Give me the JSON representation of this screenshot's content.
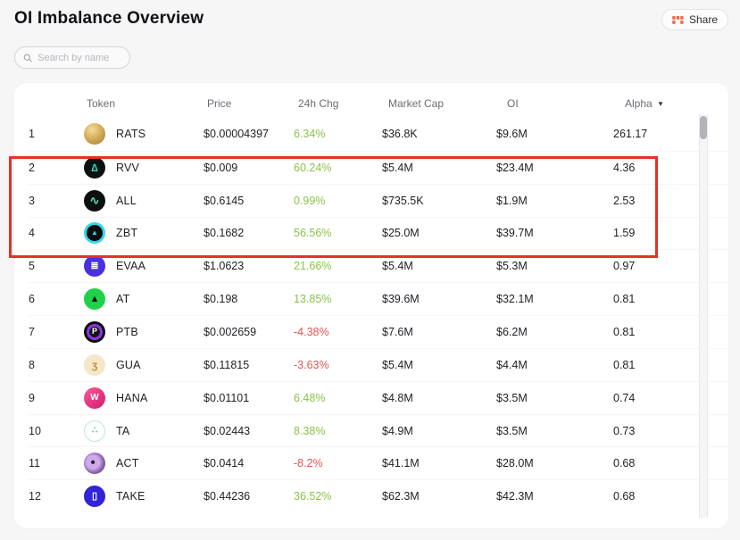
{
  "page": {
    "title": "OI Imbalance Overview"
  },
  "header": {
    "share_label": "Share",
    "share_icon": "blocks-icon",
    "share_icon_color": "#f26a4b"
  },
  "search": {
    "placeholder": "Search by name",
    "icon": "search-icon"
  },
  "colors": {
    "positive": "#8bc34a",
    "negative": "#e8544c"
  },
  "table": {
    "columns": [
      "Token",
      "Price",
      "24h Chg",
      "Market Cap",
      "OI",
      "Alpha"
    ],
    "sort_column": "Alpha",
    "sort_caret": "▾",
    "highlight": {
      "rows": [
        2,
        3,
        4
      ],
      "border_color": "#e53126"
    },
    "rows": [
      {
        "rank": "1",
        "symbol": "RATS",
        "price": "$0.00004397",
        "change": "6.34%",
        "market_cap": "$36.8K",
        "oi": "$9.6M",
        "alpha": "261.17",
        "icon": {
          "name": "rats-coin-icon",
          "bg": "radial-gradient(circle at 38% 30%, #f4dc96, #d2a957 50%, #a8823a 95%)",
          "glyph": "",
          "color": "#8a6a2a",
          "size": "9px"
        }
      },
      {
        "rank": "2",
        "symbol": "RVV",
        "price": "$0.009",
        "change": "60.24%",
        "market_cap": "$5.4M",
        "oi": "$23.4M",
        "alpha": "4.36",
        "icon": {
          "name": "rvv-icon",
          "bg": "#0c1110",
          "glyph": "∆",
          "color": "#2fd0bd",
          "size": "12px"
        }
      },
      {
        "rank": "3",
        "symbol": "ALL",
        "price": "$0.6145",
        "change": "0.99%",
        "market_cap": "$735.5K",
        "oi": "$1.9M",
        "alpha": "2.53",
        "icon": {
          "name": "all-icon",
          "bg": "#0c1110",
          "glyph": "∿",
          "color": "#64d9a8",
          "size": "13px"
        }
      },
      {
        "rank": "4",
        "symbol": "ZBT",
        "price": "$0.1682",
        "change": "56.56%",
        "market_cap": "$25.0M",
        "oi": "$39.7M",
        "alpha": "1.59",
        "icon": {
          "name": "zbt-icon",
          "bg": "#0b0d0d",
          "border": "3px solid #38d5e8",
          "glyph": "▲",
          "color": "#38d5e8",
          "size": "8px"
        }
      },
      {
        "rank": "5",
        "symbol": "EVAA",
        "price": "$1.0623",
        "change": "21.66%",
        "market_cap": "$5.4M",
        "oi": "$5.3M",
        "alpha": "0.97",
        "icon": {
          "name": "evaa-icon",
          "bg": "#4a30e2",
          "glyph": "≣",
          "color": "#ffffff",
          "size": "11px"
        }
      },
      {
        "rank": "6",
        "symbol": "AT",
        "price": "$0.198",
        "change": "13.85%",
        "market_cap": "$39.6M",
        "oi": "$32.1M",
        "alpha": "0.81",
        "icon": {
          "name": "at-icon",
          "bg": "#1ed24b",
          "glyph": "▲",
          "color": "#0d0f0d",
          "size": "11px"
        }
      },
      {
        "rank": "7",
        "symbol": "PTB",
        "price": "$0.002659",
        "change": "-4.38%",
        "market_cap": "$7.6M",
        "oi": "$6.2M",
        "alpha": "0.81",
        "icon": {
          "name": "ptb-icon",
          "bg": "radial-gradient(circle, #16161a 0 34%, #8d34e6 36% 52%, #0b0b0e 54%)",
          "glyph": "P",
          "color": "#ffffff",
          "size": "9px"
        }
      },
      {
        "rank": "8",
        "symbol": "GUA",
        "price": "$0.11815",
        "change": "-3.63%",
        "market_cap": "$5.4M",
        "oi": "$4.4M",
        "alpha": "0.81",
        "icon": {
          "name": "gua-icon",
          "bg": "#f5e7c8",
          "glyph": "ʒ",
          "color": "#bd8f4c",
          "size": "12px"
        }
      },
      {
        "rank": "9",
        "symbol": "HANA",
        "price": "$0.01101",
        "change": "6.48%",
        "market_cap": "$4.8M",
        "oi": "$3.5M",
        "alpha": "0.74",
        "icon": {
          "name": "hana-icon",
          "bg": "linear-gradient(140deg, #f85b9b, #d31a6e)",
          "glyph": "W",
          "color": "#ffffff",
          "size": "10px"
        }
      },
      {
        "rank": "10",
        "symbol": "TA",
        "price": "$0.02443",
        "change": "8.38%",
        "market_cap": "$4.9M",
        "oi": "$3.5M",
        "alpha": "0.73",
        "icon": {
          "name": "ta-icon",
          "bg": "#ffffff",
          "border": "1px solid #bfe9dc",
          "glyph": "∴",
          "color": "#35c99e",
          "size": "10px"
        }
      },
      {
        "rank": "11",
        "symbol": "ACT",
        "price": "$0.0414",
        "change": "-8.2%",
        "market_cap": "$41.1M",
        "oi": "$28.0M",
        "alpha": "0.68",
        "icon": {
          "name": "act-avatar",
          "bg": "radial-gradient(circle at 42% 45%, #2b2135 0 10%, #cfa9ea 12% 38%, #8a62ad 62%, #503668)",
          "glyph": "",
          "color": "#2b2135",
          "size": "9px"
        }
      },
      {
        "rank": "12",
        "symbol": "TAKE",
        "price": "$0.44236",
        "change": "36.52%",
        "market_cap": "$62.3M",
        "oi": "$42.3M",
        "alpha": "0.68",
        "icon": {
          "name": "take-icon",
          "bg": "#3222d8",
          "glyph": "▯",
          "color": "#ffffff",
          "size": "11px"
        }
      }
    ]
  }
}
